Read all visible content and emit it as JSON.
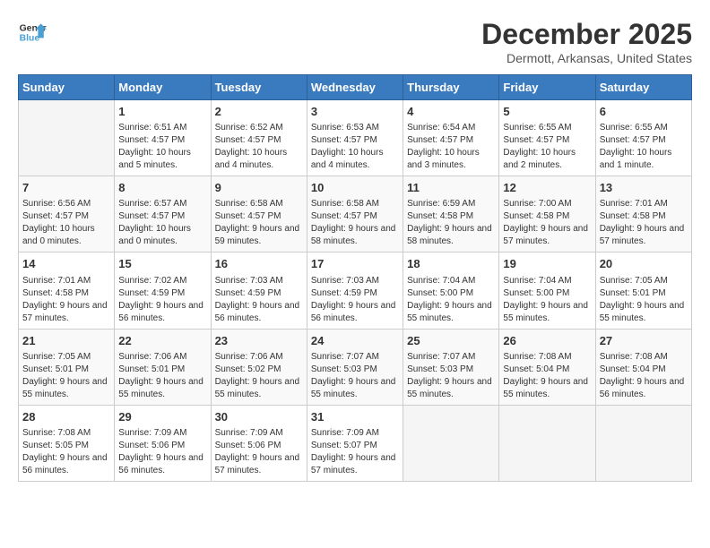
{
  "header": {
    "logo_line1": "General",
    "logo_line2": "Blue",
    "month_title": "December 2025",
    "location": "Dermott, Arkansas, United States"
  },
  "weekdays": [
    "Sunday",
    "Monday",
    "Tuesday",
    "Wednesday",
    "Thursday",
    "Friday",
    "Saturday"
  ],
  "weeks": [
    [
      {
        "day": "",
        "sunrise": "",
        "sunset": "",
        "daylight": "",
        "empty": true
      },
      {
        "day": "1",
        "sunrise": "Sunrise: 6:51 AM",
        "sunset": "Sunset: 4:57 PM",
        "daylight": "Daylight: 10 hours and 5 minutes."
      },
      {
        "day": "2",
        "sunrise": "Sunrise: 6:52 AM",
        "sunset": "Sunset: 4:57 PM",
        "daylight": "Daylight: 10 hours and 4 minutes."
      },
      {
        "day": "3",
        "sunrise": "Sunrise: 6:53 AM",
        "sunset": "Sunset: 4:57 PM",
        "daylight": "Daylight: 10 hours and 4 minutes."
      },
      {
        "day": "4",
        "sunrise": "Sunrise: 6:54 AM",
        "sunset": "Sunset: 4:57 PM",
        "daylight": "Daylight: 10 hours and 3 minutes."
      },
      {
        "day": "5",
        "sunrise": "Sunrise: 6:55 AM",
        "sunset": "Sunset: 4:57 PM",
        "daylight": "Daylight: 10 hours and 2 minutes."
      },
      {
        "day": "6",
        "sunrise": "Sunrise: 6:55 AM",
        "sunset": "Sunset: 4:57 PM",
        "daylight": "Daylight: 10 hours and 1 minute."
      }
    ],
    [
      {
        "day": "7",
        "sunrise": "Sunrise: 6:56 AM",
        "sunset": "Sunset: 4:57 PM",
        "daylight": "Daylight: 10 hours and 0 minutes."
      },
      {
        "day": "8",
        "sunrise": "Sunrise: 6:57 AM",
        "sunset": "Sunset: 4:57 PM",
        "daylight": "Daylight: 10 hours and 0 minutes."
      },
      {
        "day": "9",
        "sunrise": "Sunrise: 6:58 AM",
        "sunset": "Sunset: 4:57 PM",
        "daylight": "Daylight: 9 hours and 59 minutes."
      },
      {
        "day": "10",
        "sunrise": "Sunrise: 6:58 AM",
        "sunset": "Sunset: 4:57 PM",
        "daylight": "Daylight: 9 hours and 58 minutes."
      },
      {
        "day": "11",
        "sunrise": "Sunrise: 6:59 AM",
        "sunset": "Sunset: 4:58 PM",
        "daylight": "Daylight: 9 hours and 58 minutes."
      },
      {
        "day": "12",
        "sunrise": "Sunrise: 7:00 AM",
        "sunset": "Sunset: 4:58 PM",
        "daylight": "Daylight: 9 hours and 57 minutes."
      },
      {
        "day": "13",
        "sunrise": "Sunrise: 7:01 AM",
        "sunset": "Sunset: 4:58 PM",
        "daylight": "Daylight: 9 hours and 57 minutes."
      }
    ],
    [
      {
        "day": "14",
        "sunrise": "Sunrise: 7:01 AM",
        "sunset": "Sunset: 4:58 PM",
        "daylight": "Daylight: 9 hours and 57 minutes."
      },
      {
        "day": "15",
        "sunrise": "Sunrise: 7:02 AM",
        "sunset": "Sunset: 4:59 PM",
        "daylight": "Daylight: 9 hours and 56 minutes."
      },
      {
        "day": "16",
        "sunrise": "Sunrise: 7:03 AM",
        "sunset": "Sunset: 4:59 PM",
        "daylight": "Daylight: 9 hours and 56 minutes."
      },
      {
        "day": "17",
        "sunrise": "Sunrise: 7:03 AM",
        "sunset": "Sunset: 4:59 PM",
        "daylight": "Daylight: 9 hours and 56 minutes."
      },
      {
        "day": "18",
        "sunrise": "Sunrise: 7:04 AM",
        "sunset": "Sunset: 5:00 PM",
        "daylight": "Daylight: 9 hours and 55 minutes."
      },
      {
        "day": "19",
        "sunrise": "Sunrise: 7:04 AM",
        "sunset": "Sunset: 5:00 PM",
        "daylight": "Daylight: 9 hours and 55 minutes."
      },
      {
        "day": "20",
        "sunrise": "Sunrise: 7:05 AM",
        "sunset": "Sunset: 5:01 PM",
        "daylight": "Daylight: 9 hours and 55 minutes."
      }
    ],
    [
      {
        "day": "21",
        "sunrise": "Sunrise: 7:05 AM",
        "sunset": "Sunset: 5:01 PM",
        "daylight": "Daylight: 9 hours and 55 minutes."
      },
      {
        "day": "22",
        "sunrise": "Sunrise: 7:06 AM",
        "sunset": "Sunset: 5:01 PM",
        "daylight": "Daylight: 9 hours and 55 minutes."
      },
      {
        "day": "23",
        "sunrise": "Sunrise: 7:06 AM",
        "sunset": "Sunset: 5:02 PM",
        "daylight": "Daylight: 9 hours and 55 minutes."
      },
      {
        "day": "24",
        "sunrise": "Sunrise: 7:07 AM",
        "sunset": "Sunset: 5:03 PM",
        "daylight": "Daylight: 9 hours and 55 minutes."
      },
      {
        "day": "25",
        "sunrise": "Sunrise: 7:07 AM",
        "sunset": "Sunset: 5:03 PM",
        "daylight": "Daylight: 9 hours and 55 minutes."
      },
      {
        "day": "26",
        "sunrise": "Sunrise: 7:08 AM",
        "sunset": "Sunset: 5:04 PM",
        "daylight": "Daylight: 9 hours and 55 minutes."
      },
      {
        "day": "27",
        "sunrise": "Sunrise: 7:08 AM",
        "sunset": "Sunset: 5:04 PM",
        "daylight": "Daylight: 9 hours and 56 minutes."
      }
    ],
    [
      {
        "day": "28",
        "sunrise": "Sunrise: 7:08 AM",
        "sunset": "Sunset: 5:05 PM",
        "daylight": "Daylight: 9 hours and 56 minutes."
      },
      {
        "day": "29",
        "sunrise": "Sunrise: 7:09 AM",
        "sunset": "Sunset: 5:06 PM",
        "daylight": "Daylight: 9 hours and 56 minutes."
      },
      {
        "day": "30",
        "sunrise": "Sunrise: 7:09 AM",
        "sunset": "Sunset: 5:06 PM",
        "daylight": "Daylight: 9 hours and 57 minutes."
      },
      {
        "day": "31",
        "sunrise": "Sunrise: 7:09 AM",
        "sunset": "Sunset: 5:07 PM",
        "daylight": "Daylight: 9 hours and 57 minutes."
      },
      {
        "day": "",
        "sunrise": "",
        "sunset": "",
        "daylight": "",
        "empty": true
      },
      {
        "day": "",
        "sunrise": "",
        "sunset": "",
        "daylight": "",
        "empty": true
      },
      {
        "day": "",
        "sunrise": "",
        "sunset": "",
        "daylight": "",
        "empty": true
      }
    ]
  ]
}
